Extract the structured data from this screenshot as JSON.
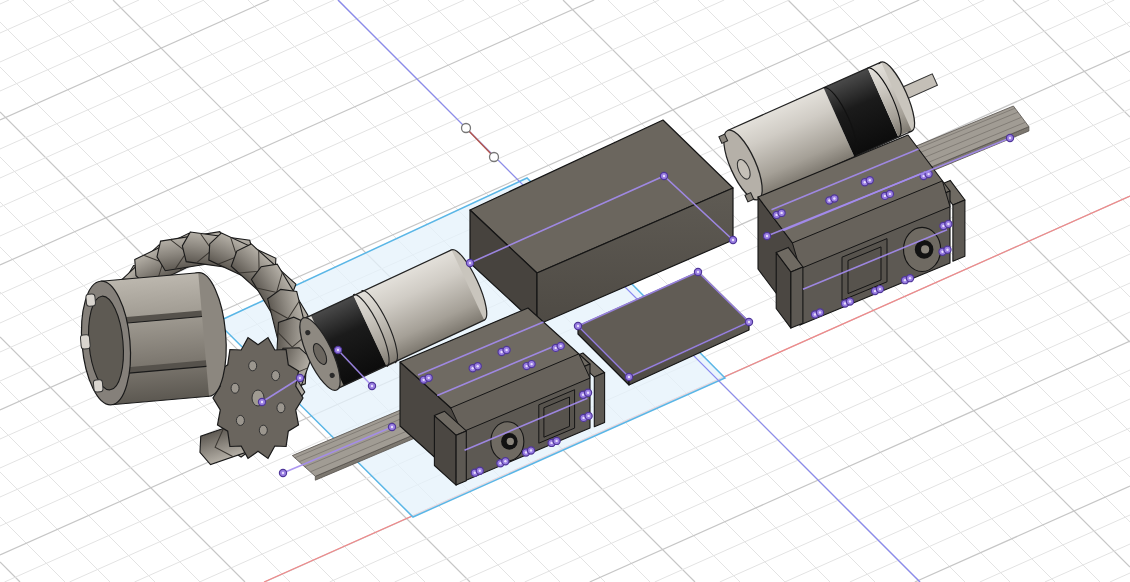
{
  "viewport": {
    "grid": true,
    "axes": true,
    "origin": true
  },
  "sketch": {
    "profile": true,
    "lines": true
  },
  "components": [
    {
      "kind": "motor"
    },
    {
      "kind": "block"
    },
    {
      "kind": "servo"
    },
    {
      "kind": "plate"
    },
    {
      "kind": "wheel"
    },
    {
      "kind": "motor"
    },
    {
      "kind": "servo"
    }
  ]
}
